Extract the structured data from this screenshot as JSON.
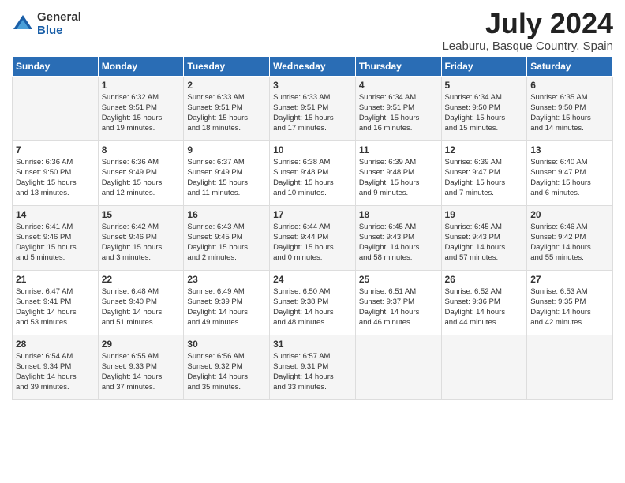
{
  "header": {
    "logo_general": "General",
    "logo_blue": "Blue",
    "month_year": "July 2024",
    "location": "Leaburu, Basque Country, Spain"
  },
  "weekdays": [
    "Sunday",
    "Monday",
    "Tuesday",
    "Wednesday",
    "Thursday",
    "Friday",
    "Saturday"
  ],
  "weeks": [
    [
      {
        "day": "",
        "text": ""
      },
      {
        "day": "1",
        "text": "Sunrise: 6:32 AM\nSunset: 9:51 PM\nDaylight: 15 hours\nand 19 minutes."
      },
      {
        "day": "2",
        "text": "Sunrise: 6:33 AM\nSunset: 9:51 PM\nDaylight: 15 hours\nand 18 minutes."
      },
      {
        "day": "3",
        "text": "Sunrise: 6:33 AM\nSunset: 9:51 PM\nDaylight: 15 hours\nand 17 minutes."
      },
      {
        "day": "4",
        "text": "Sunrise: 6:34 AM\nSunset: 9:51 PM\nDaylight: 15 hours\nand 16 minutes."
      },
      {
        "day": "5",
        "text": "Sunrise: 6:34 AM\nSunset: 9:50 PM\nDaylight: 15 hours\nand 15 minutes."
      },
      {
        "day": "6",
        "text": "Sunrise: 6:35 AM\nSunset: 9:50 PM\nDaylight: 15 hours\nand 14 minutes."
      }
    ],
    [
      {
        "day": "7",
        "text": "Sunrise: 6:36 AM\nSunset: 9:50 PM\nDaylight: 15 hours\nand 13 minutes."
      },
      {
        "day": "8",
        "text": "Sunrise: 6:36 AM\nSunset: 9:49 PM\nDaylight: 15 hours\nand 12 minutes."
      },
      {
        "day": "9",
        "text": "Sunrise: 6:37 AM\nSunset: 9:49 PM\nDaylight: 15 hours\nand 11 minutes."
      },
      {
        "day": "10",
        "text": "Sunrise: 6:38 AM\nSunset: 9:48 PM\nDaylight: 15 hours\nand 10 minutes."
      },
      {
        "day": "11",
        "text": "Sunrise: 6:39 AM\nSunset: 9:48 PM\nDaylight: 15 hours\nand 9 minutes."
      },
      {
        "day": "12",
        "text": "Sunrise: 6:39 AM\nSunset: 9:47 PM\nDaylight: 15 hours\nand 7 minutes."
      },
      {
        "day": "13",
        "text": "Sunrise: 6:40 AM\nSunset: 9:47 PM\nDaylight: 15 hours\nand 6 minutes."
      }
    ],
    [
      {
        "day": "14",
        "text": "Sunrise: 6:41 AM\nSunset: 9:46 PM\nDaylight: 15 hours\nand 5 minutes."
      },
      {
        "day": "15",
        "text": "Sunrise: 6:42 AM\nSunset: 9:46 PM\nDaylight: 15 hours\nand 3 minutes."
      },
      {
        "day": "16",
        "text": "Sunrise: 6:43 AM\nSunset: 9:45 PM\nDaylight: 15 hours\nand 2 minutes."
      },
      {
        "day": "17",
        "text": "Sunrise: 6:44 AM\nSunset: 9:44 PM\nDaylight: 15 hours\nand 0 minutes."
      },
      {
        "day": "18",
        "text": "Sunrise: 6:45 AM\nSunset: 9:43 PM\nDaylight: 14 hours\nand 58 minutes."
      },
      {
        "day": "19",
        "text": "Sunrise: 6:45 AM\nSunset: 9:43 PM\nDaylight: 14 hours\nand 57 minutes."
      },
      {
        "day": "20",
        "text": "Sunrise: 6:46 AM\nSunset: 9:42 PM\nDaylight: 14 hours\nand 55 minutes."
      }
    ],
    [
      {
        "day": "21",
        "text": "Sunrise: 6:47 AM\nSunset: 9:41 PM\nDaylight: 14 hours\nand 53 minutes."
      },
      {
        "day": "22",
        "text": "Sunrise: 6:48 AM\nSunset: 9:40 PM\nDaylight: 14 hours\nand 51 minutes."
      },
      {
        "day": "23",
        "text": "Sunrise: 6:49 AM\nSunset: 9:39 PM\nDaylight: 14 hours\nand 49 minutes."
      },
      {
        "day": "24",
        "text": "Sunrise: 6:50 AM\nSunset: 9:38 PM\nDaylight: 14 hours\nand 48 minutes."
      },
      {
        "day": "25",
        "text": "Sunrise: 6:51 AM\nSunset: 9:37 PM\nDaylight: 14 hours\nand 46 minutes."
      },
      {
        "day": "26",
        "text": "Sunrise: 6:52 AM\nSunset: 9:36 PM\nDaylight: 14 hours\nand 44 minutes."
      },
      {
        "day": "27",
        "text": "Sunrise: 6:53 AM\nSunset: 9:35 PM\nDaylight: 14 hours\nand 42 minutes."
      }
    ],
    [
      {
        "day": "28",
        "text": "Sunrise: 6:54 AM\nSunset: 9:34 PM\nDaylight: 14 hours\nand 39 minutes."
      },
      {
        "day": "29",
        "text": "Sunrise: 6:55 AM\nSunset: 9:33 PM\nDaylight: 14 hours\nand 37 minutes."
      },
      {
        "day": "30",
        "text": "Sunrise: 6:56 AM\nSunset: 9:32 PM\nDaylight: 14 hours\nand 35 minutes."
      },
      {
        "day": "31",
        "text": "Sunrise: 6:57 AM\nSunset: 9:31 PM\nDaylight: 14 hours\nand 33 minutes."
      },
      {
        "day": "",
        "text": ""
      },
      {
        "day": "",
        "text": ""
      },
      {
        "day": "",
        "text": ""
      }
    ]
  ]
}
